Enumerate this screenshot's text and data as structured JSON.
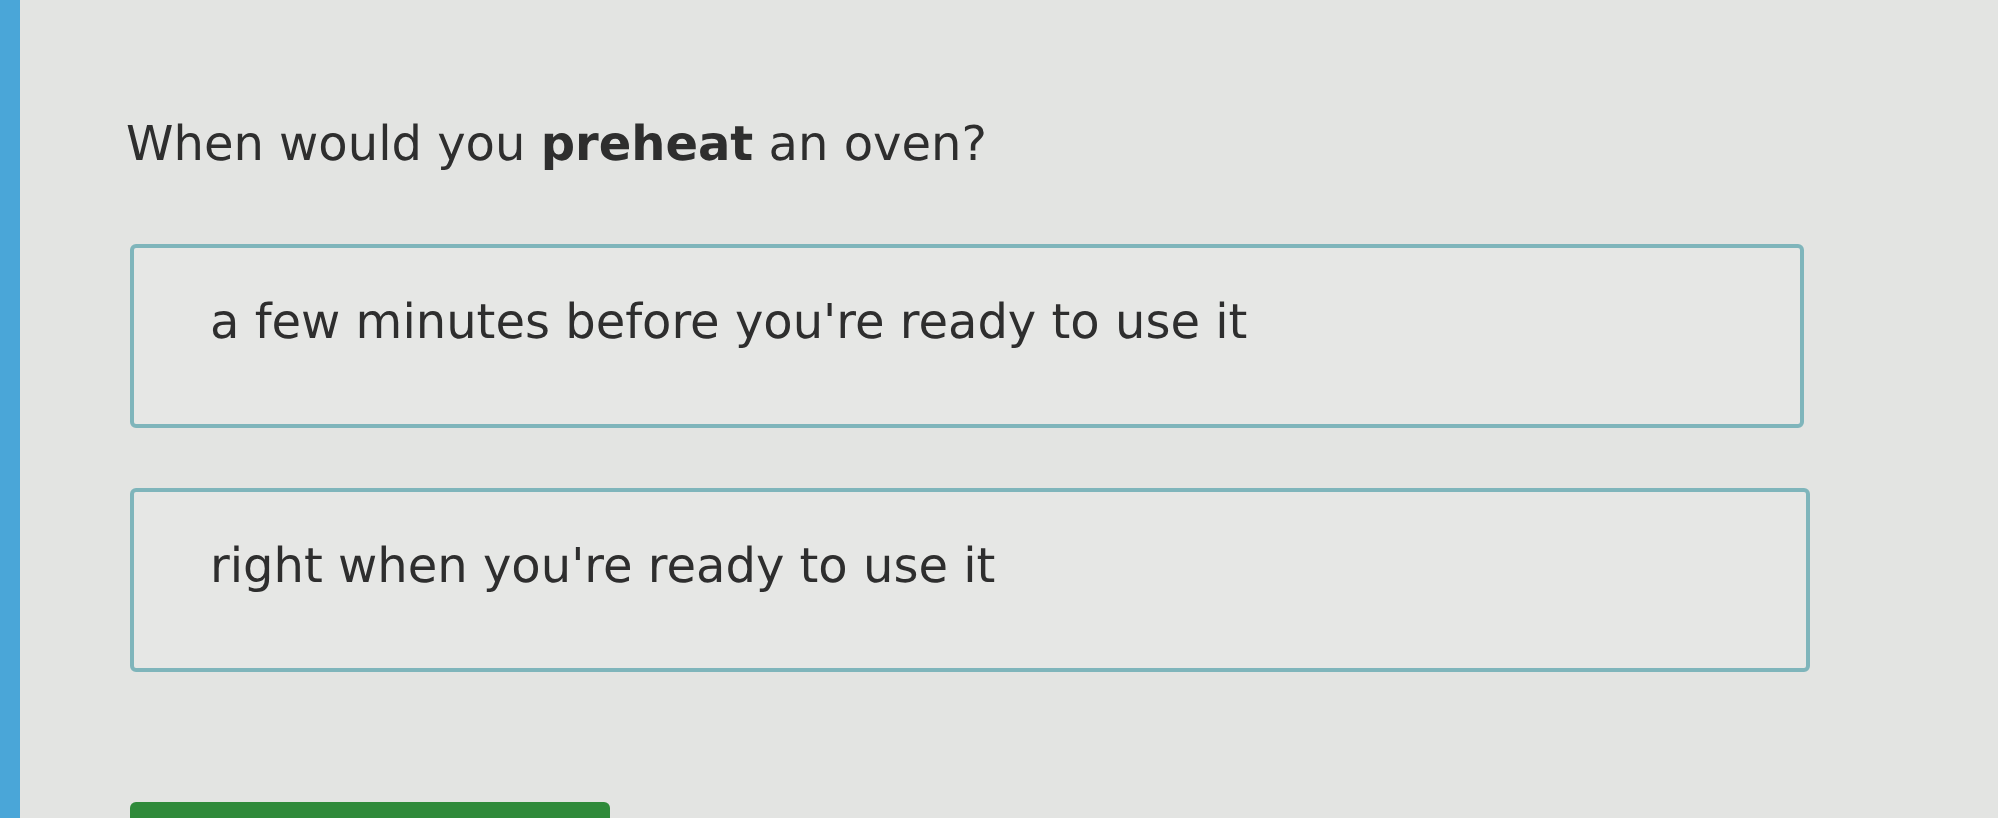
{
  "question": "When would you **preheat** an oven?",
  "options": [
    {
      "label": "a few minutes before you're ready to use it",
      "selected": false
    },
    {
      "label": "right when you're ready to use it",
      "selected": false
    }
  ]
}
